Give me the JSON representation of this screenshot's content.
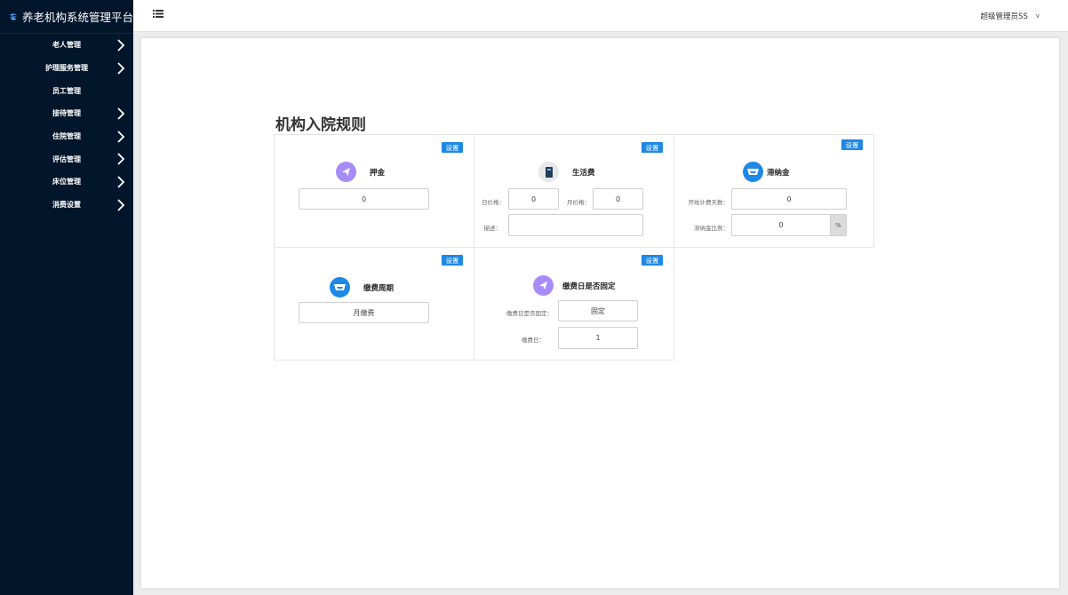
{
  "brand": {
    "title": "养老机构系统管理平台",
    "logo_icon": "logo-icon"
  },
  "sidebar": {
    "items": [
      {
        "label": "老人管理",
        "has_arrow": true
      },
      {
        "label": "护理服务管理",
        "has_arrow": true
      },
      {
        "label": "员工管理",
        "has_arrow": false
      },
      {
        "label": "接待管理",
        "has_arrow": true
      },
      {
        "label": "住院管理",
        "has_arrow": true
      },
      {
        "label": "评估管理",
        "has_arrow": true
      },
      {
        "label": "床位管理",
        "has_arrow": true
      },
      {
        "label": "消费设置",
        "has_arrow": true
      }
    ]
  },
  "topbar": {
    "menu_toggle_icon": "list-icon",
    "user": "超级管理员SS",
    "user_caret": "v"
  },
  "page": {
    "title": "机构入院规则"
  },
  "cards": {
    "deposit": {
      "set_label": "设置",
      "title": "押金",
      "icon": "send-icon",
      "value": "0"
    },
    "living_fee": {
      "set_label": "设置",
      "title": "生活费",
      "icon": "book-icon",
      "day_price_label": "日价格：",
      "day_price": "0",
      "month_price_label": "月价格：",
      "month_price": "0",
      "desc_label": "描述：",
      "desc": ""
    },
    "lag_fee": {
      "set_label": "设置",
      "title": "滞纳金",
      "icon": "inbox-icon",
      "start_days_label": "开始计费天数：",
      "start_days": "0",
      "ratio_label": "滞纳金比例：",
      "ratio": "0",
      "ratio_suffix": "%"
    },
    "pay_cycle": {
      "set_label": "设置",
      "title": "缴费周期",
      "icon": "inbox-icon",
      "value": "月缴费"
    },
    "pay_day": {
      "set_label": "设置",
      "title": "缴费日是否固定",
      "icon": "send-icon",
      "fixed_label": "缴费日是否固定：",
      "fixed": "固定",
      "day_label": "缴费日：",
      "day": "1"
    }
  },
  "colors": {
    "sidebar_bg": "#02162b",
    "accent": "#1e88e5",
    "purple_icon": "#a78bfa",
    "blue_icon": "#1e88e5"
  }
}
